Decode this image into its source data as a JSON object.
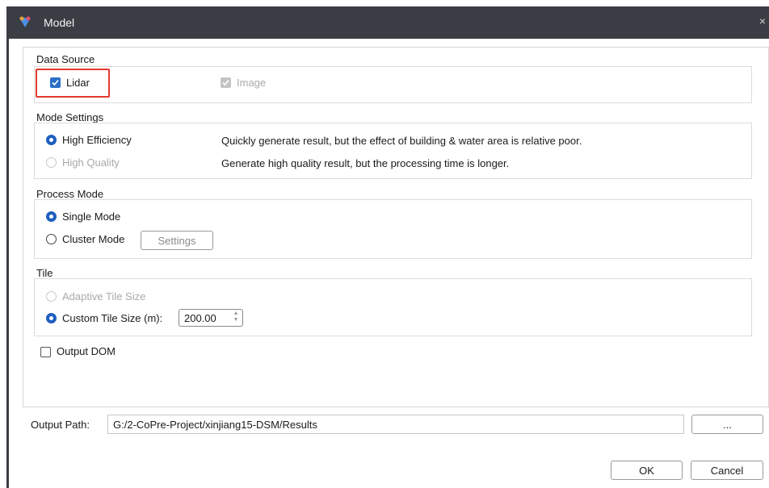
{
  "window": {
    "title": "Model",
    "close_symbol": "×"
  },
  "data_source": {
    "title": "Data Source",
    "lidar": {
      "label": "Lidar",
      "checked": true
    },
    "image": {
      "label": "Image",
      "checked": true,
      "disabled": true
    }
  },
  "mode_settings": {
    "title": "Mode Settings",
    "options": [
      {
        "label": "High Efficiency",
        "selected": true,
        "disabled": false,
        "description": "Quickly generate result, but the effect of building & water area is relative poor."
      },
      {
        "label": "High Quality",
        "selected": false,
        "disabled": true,
        "description": "Generate high quality result, but the processing time is longer."
      }
    ]
  },
  "process_mode": {
    "title": "Process Mode",
    "single": {
      "label": "Single Mode",
      "selected": true
    },
    "cluster": {
      "label": "Cluster Mode",
      "selected": false
    },
    "settings_button": "Settings"
  },
  "tile": {
    "title": "Tile",
    "adaptive": {
      "label": "Adaptive Tile Size",
      "selected": false,
      "disabled": true
    },
    "custom": {
      "label": "Custom Tile Size (m):",
      "selected": true
    },
    "custom_value": "200.00"
  },
  "output_dom": {
    "label": "Output DOM",
    "checked": false
  },
  "output_path": {
    "label": "Output Path:",
    "value": "G:/2-CoPre-Project/xinjiang15-DSM/Results",
    "browse_label": "..."
  },
  "buttons": {
    "ok": "OK",
    "cancel": "Cancel"
  },
  "colors": {
    "accent": "#1f5fbf",
    "titlebar": "#3a3d44",
    "highlight": "#e23b2e"
  }
}
